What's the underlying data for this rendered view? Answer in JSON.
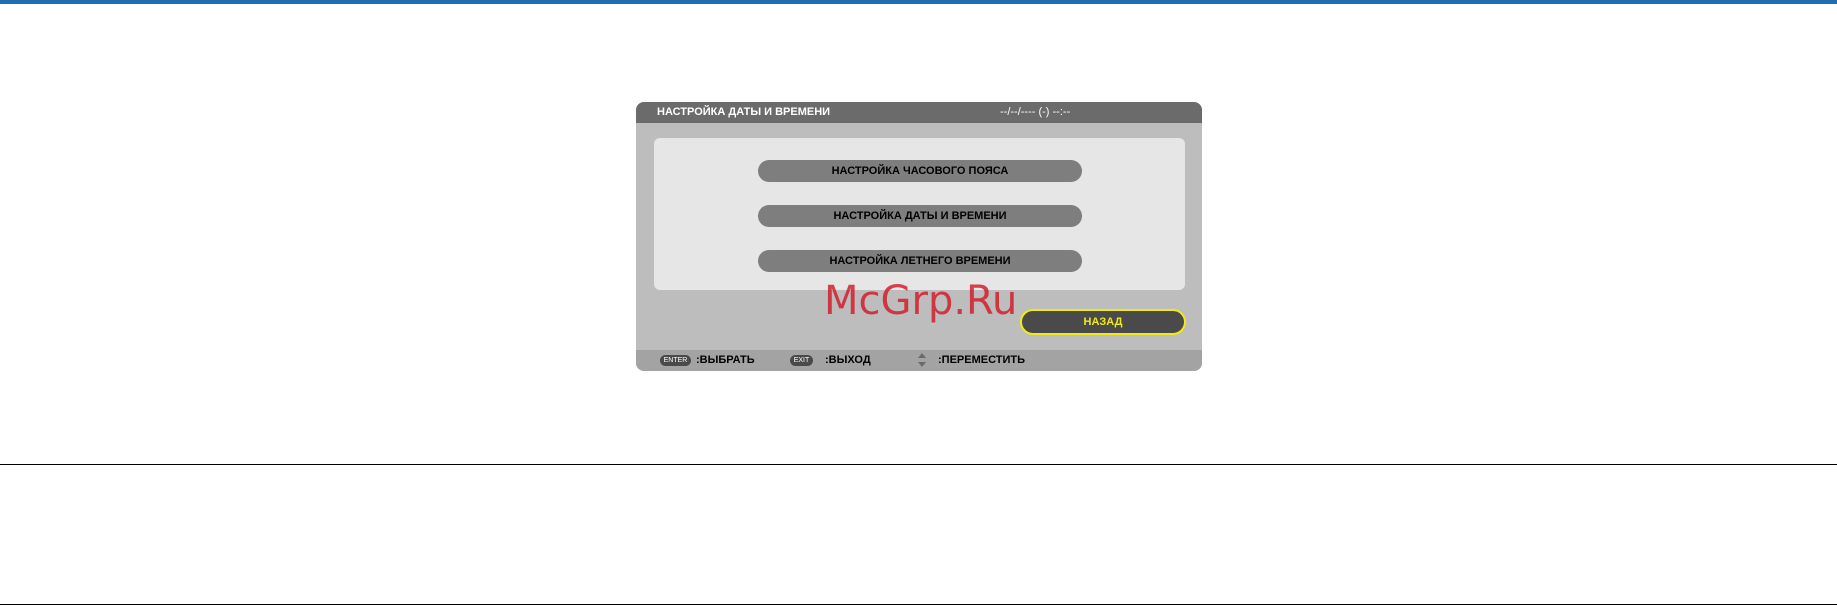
{
  "dialog": {
    "title": "НАСТРОЙКА ДАТЫ И ВРЕМЕНИ",
    "datetime": "--/--/---- (-) --:--",
    "menu_items": [
      {
        "label": "НАСТРОЙКА ЧАСОВОГО ПОЯСА"
      },
      {
        "label": "НАСТРОЙКА ДАТЫ И ВРЕМЕНИ"
      },
      {
        "label": "НАСТРОЙКА ЛЕТНЕГО ВРЕМЕНИ"
      }
    ],
    "back_label": "НАЗАД"
  },
  "statusbar": {
    "enter_key": "ENTER",
    "enter_text": ":ВЫБРАТЬ",
    "exit_key": "EXIT",
    "exit_text": ":ВЫХОД",
    "move_icon": "up-down-arrows-icon",
    "move_text": ":ПЕРЕМЕСТИТЬ"
  },
  "watermark": "McGrp.Ru",
  "colors": {
    "accent_rule": "#1f6db5",
    "dialog_bg": "#bdbdbd",
    "titlebar_bg": "#6b6b6b",
    "panel_bg": "#e6e6e6",
    "menu_button": "#7e7e7e",
    "focus_highlight": "#f2ea16",
    "watermark": "#d21928"
  }
}
